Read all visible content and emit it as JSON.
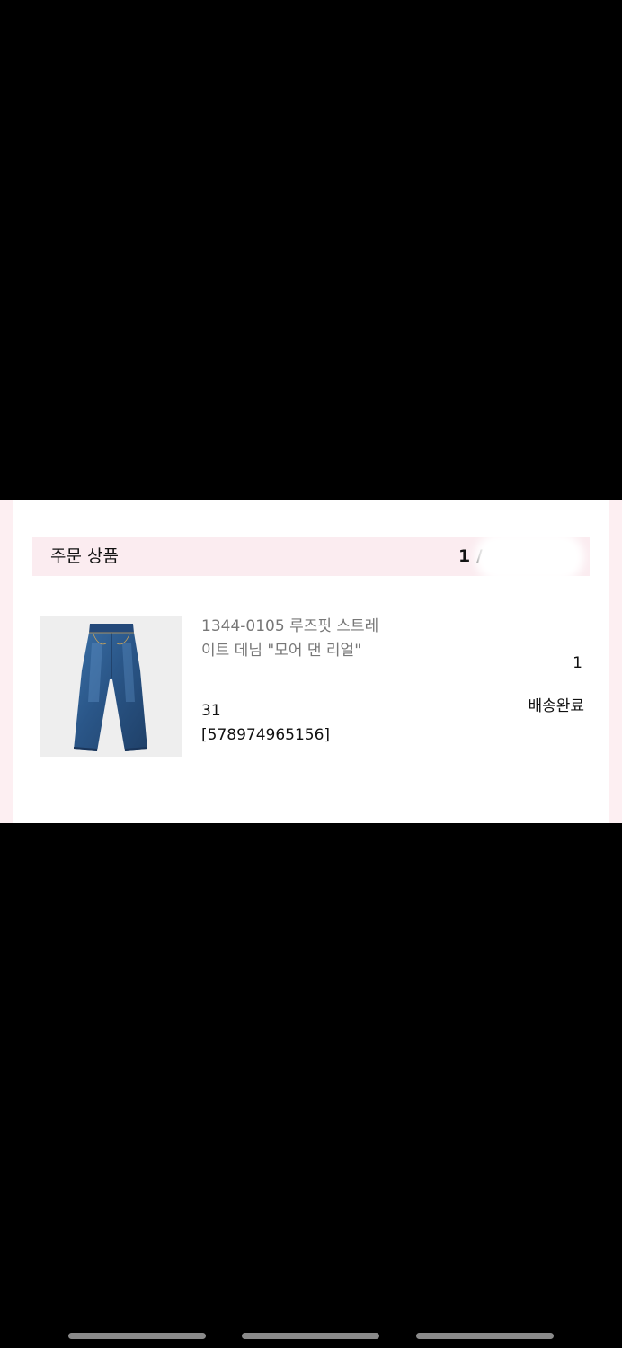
{
  "order_section": {
    "title": "주문 상품",
    "count": "1 /"
  },
  "product": {
    "image_icon": "jeans-icon",
    "name": "1344-0105 루즈핏 스트레이트 데님 \"모어 댄 리얼\"",
    "option": "31",
    "code": "[578974965156]",
    "quantity": "1",
    "status": "배송완료"
  },
  "colors": {
    "header_bg": "#fbecf0",
    "card_edge": "#fdeff2",
    "name_text": "#777777",
    "denim": "#2d5a8c"
  }
}
